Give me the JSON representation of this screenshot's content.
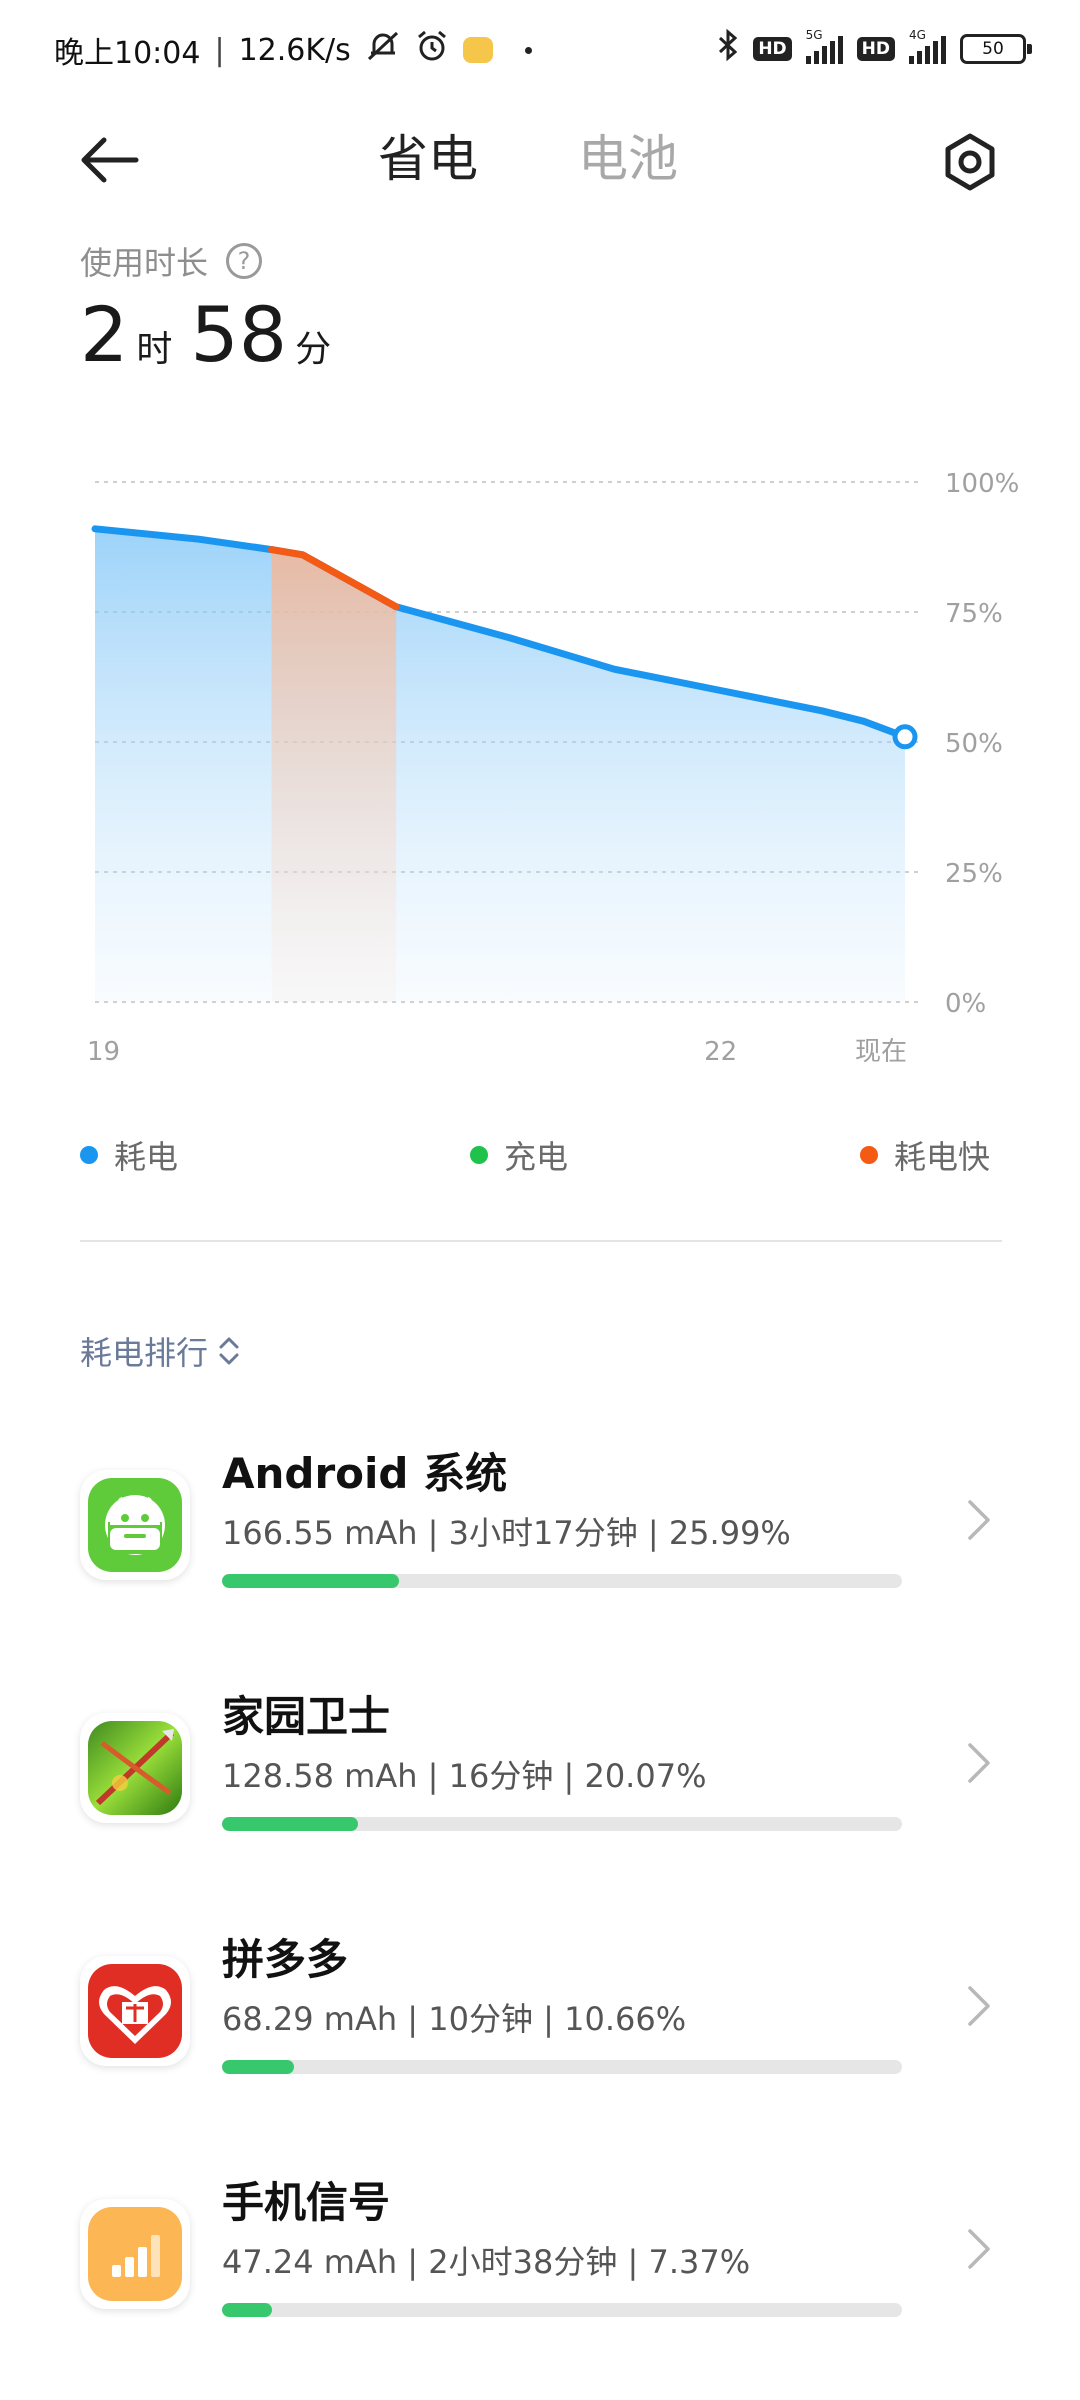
{
  "status_bar": {
    "time": "晚上10:04",
    "speed": "12.6K/s",
    "battery": "50",
    "net_5g": "5G",
    "net_4g": "4G",
    "hd": "HD"
  },
  "header": {
    "tabs": [
      {
        "label": "省电",
        "active": true
      },
      {
        "label": "电池",
        "active": false
      }
    ]
  },
  "usage": {
    "label": "使用时长",
    "hours": "2",
    "hours_unit": "时",
    "minutes": "58",
    "minutes_unit": "分"
  },
  "chart_data": {
    "type": "area",
    "y_tick_labels": [
      "100%",
      "75%",
      "50%",
      "25%",
      "0%"
    ],
    "x_tick_labels": [
      "19",
      "22",
      "现在"
    ],
    "ylim": [
      0,
      100
    ],
    "x_range_hours": [
      19,
      22.9
    ],
    "grid": true,
    "series": [
      {
        "name": "耗电",
        "color": "#1a96f0",
        "x": [
          19.0,
          19.5,
          19.85,
          20.0,
          20.45,
          21.0,
          21.5,
          22.0,
          22.5,
          22.7,
          22.9
        ],
        "y": [
          91,
          89,
          87,
          86,
          76,
          70,
          64,
          60,
          56,
          54,
          51
        ]
      }
    ],
    "fast_drain_range": [
      19.85,
      20.45
    ],
    "fast_drain_color": "#f55a14"
  },
  "legend": [
    {
      "label": "耗电",
      "color": "#1a96f0"
    },
    {
      "label": "充电",
      "color": "#1fc24b"
    },
    {
      "label": "耗电快",
      "color": "#f55a14"
    }
  ],
  "ranking": {
    "label": "耗电排行"
  },
  "apps": [
    {
      "name": "Android 系统",
      "stats": "166.55 mAh | 3小时17分钟 | 25.99%",
      "percent": 25.99,
      "icon": "android-icon"
    },
    {
      "name": "家园卫士",
      "stats": "128.58 mAh | 16分钟 | 20.07%",
      "percent": 20.07,
      "icon": "home-guard-game-icon"
    },
    {
      "name": "拼多多",
      "stats": "68.29 mAh | 10分钟 | 10.66%",
      "percent": 10.66,
      "icon": "pinduoduo-icon"
    },
    {
      "name": "手机信号",
      "stats": "47.24 mAh | 2小时38分钟 | 7.37%",
      "percent": 7.37,
      "icon": "signal-icon"
    }
  ]
}
